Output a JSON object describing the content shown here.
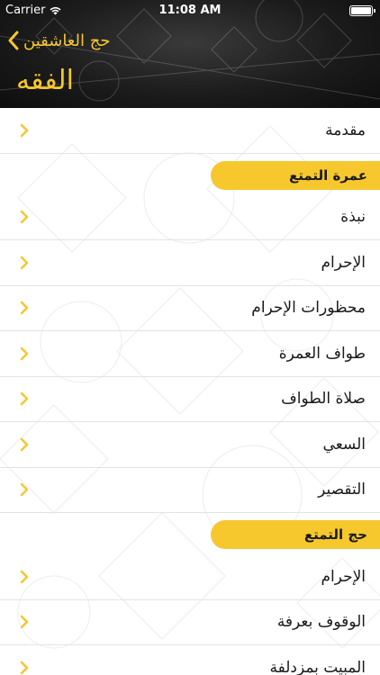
{
  "status_bar": {
    "carrier": "Carrier",
    "time": "11:08 AM"
  },
  "nav": {
    "back_label": "حج العاشقين",
    "title": "الفقه"
  },
  "colors": {
    "accent": "#f7c72e",
    "header_bg": "#1c1c1c",
    "text": "#1a1a1a"
  },
  "list": [
    {
      "kind": "row",
      "label": "مقدمة"
    },
    {
      "kind": "section",
      "label": "عمرة التمتع"
    },
    {
      "kind": "row",
      "label": "نبذة"
    },
    {
      "kind": "row",
      "label": "الإحرام"
    },
    {
      "kind": "row",
      "label": "محظورات الإحرام"
    },
    {
      "kind": "row",
      "label": "طواف العمرة"
    },
    {
      "kind": "row",
      "label": "صلاة الطواف"
    },
    {
      "kind": "row",
      "label": "السعي"
    },
    {
      "kind": "row",
      "label": "التقصير"
    },
    {
      "kind": "section",
      "label": "حج التمتع"
    },
    {
      "kind": "row",
      "label": "الإحرام"
    },
    {
      "kind": "row",
      "label": "الوقوف بعرفة"
    },
    {
      "kind": "row",
      "label": "المبيت بمزدلفة"
    }
  ]
}
